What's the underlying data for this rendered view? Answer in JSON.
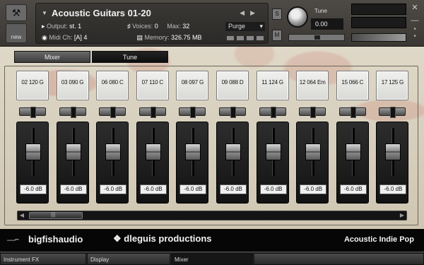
{
  "header": {
    "instrument_title": "Acoustic Guitars 01-20",
    "output_label": "Output:",
    "output_value": "st. 1",
    "voices_label": "Voices:",
    "voices_value": "0",
    "max_label": "Max:",
    "max_value": "32",
    "purge_label": "Purge",
    "midi_label": "Midi Ch:",
    "midi_value": "[A]  4",
    "memory_label": "Memory:",
    "memory_value": "326.75 MB",
    "solo_label": "S",
    "mute_label": "M",
    "tune_label": "Tune",
    "tune_value": "0.00",
    "new_label": "new"
  },
  "tabs": {
    "mixer": "Mixer",
    "tune": "Tune"
  },
  "channels": [
    {
      "name": "02 120 G",
      "db": "-6.0 dB"
    },
    {
      "name": "03 090 G",
      "db": "-6.0 dB"
    },
    {
      "name": "06 080 C",
      "db": "-6.0 dB"
    },
    {
      "name": "07 110 C",
      "db": "-6.0 dB"
    },
    {
      "name": "08 097 G",
      "db": "-6.0 dB"
    },
    {
      "name": "09 088 D",
      "db": "-6.0 dB"
    },
    {
      "name": "11 124 G",
      "db": "-6.0 dB"
    },
    {
      "name": "12 064 Em",
      "db": "-6.0 dB"
    },
    {
      "name": "15 066 C",
      "db": "-6.0 dB"
    },
    {
      "name": "17 125 G",
      "db": "-6.0 dB"
    }
  ],
  "footer": {
    "logo_left": "bigfishaudio",
    "logo_middle": "dleguis productions",
    "product": "Acoustic Indie Pop"
  },
  "bottom_tabs": {
    "instrument_fx": "Instrument FX",
    "display": "Display",
    "mixer": "Mixer"
  },
  "colors": {
    "panel_bg": "#d8d1c0",
    "floral_accent": "#c45546",
    "header_bg": "#3b3834",
    "footer_bg": "#060606"
  }
}
